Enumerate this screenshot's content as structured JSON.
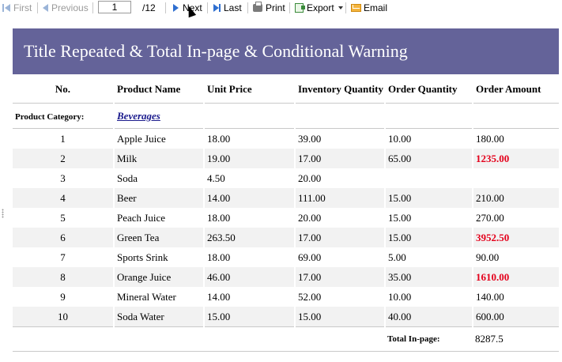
{
  "toolbar": {
    "first_label": "First",
    "previous_label": "Previous",
    "page_value": "1",
    "page_total": "/12",
    "next_label": "Next",
    "last_label": "Last",
    "print_label": "Print",
    "export_label": "Export",
    "email_label": "Email"
  },
  "report": {
    "title": "Title Repeated & Total In-page & Conditional Warning",
    "columns": [
      "No.",
      "Product Name",
      "Unit Price",
      "Inventory Quantity",
      "Order Quantity",
      "Order Amount"
    ],
    "category_label": "Product Category:",
    "category_value": "Beverages",
    "rows": [
      {
        "no": "1",
        "name": "Apple Juice",
        "price": "18.00",
        "inventory": "39.00",
        "order_qty": "10.00",
        "amount": "180.00",
        "warning": false
      },
      {
        "no": "2",
        "name": "Milk",
        "price": "19.00",
        "inventory": "17.00",
        "order_qty": "65.00",
        "amount": "1235.00",
        "warning": true
      },
      {
        "no": "3",
        "name": "Soda",
        "price": "4.50",
        "inventory": "20.00",
        "order_qty": "",
        "amount": "",
        "warning": false
      },
      {
        "no": "4",
        "name": "Beer",
        "price": "14.00",
        "inventory": "111.00",
        "order_qty": "15.00",
        "amount": "210.00",
        "warning": false
      },
      {
        "no": "5",
        "name": "Peach Juice",
        "price": "18.00",
        "inventory": "20.00",
        "order_qty": "15.00",
        "amount": "270.00",
        "warning": false
      },
      {
        "no": "6",
        "name": "Green Tea",
        "price": "263.50",
        "inventory": "17.00",
        "order_qty": "15.00",
        "amount": "3952.50",
        "warning": true
      },
      {
        "no": "7",
        "name": "Sports Srink",
        "price": "18.00",
        "inventory": "69.00",
        "order_qty": "5.00",
        "amount": "90.00",
        "warning": false
      },
      {
        "no": "8",
        "name": "Orange Juice",
        "price": "46.00",
        "inventory": "17.00",
        "order_qty": "35.00",
        "amount": "1610.00",
        "warning": true
      },
      {
        "no": "9",
        "name": "Mineral Water",
        "price": "14.00",
        "inventory": "52.00",
        "order_qty": "10.00",
        "amount": "140.00",
        "warning": false
      },
      {
        "no": "10",
        "name": "Soda Water",
        "price": "15.00",
        "inventory": "15.00",
        "order_qty": "40.00",
        "amount": "600.00",
        "warning": false
      }
    ],
    "total_label": "Total In-page:",
    "total_value": "8287.5"
  },
  "colors": {
    "banner": "#646399",
    "warning": "#e4001b",
    "shade": "#f2f2f2",
    "link": "#1a1a8c"
  }
}
